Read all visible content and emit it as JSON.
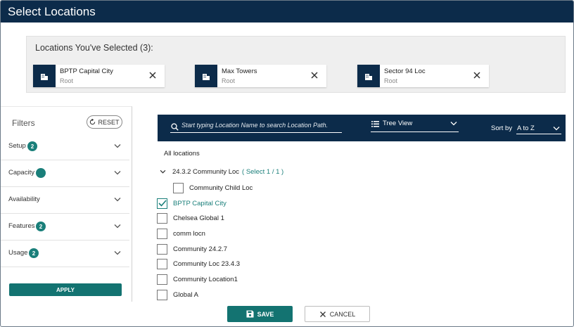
{
  "window": {
    "title": "Select Locations"
  },
  "selected": {
    "title": "Locations You've Selected (3):",
    "chips": [
      {
        "name": "BPTP Capital City",
        "path": "Root"
      },
      {
        "name": "Max Towers",
        "path": "Root"
      },
      {
        "name": "Sector 94 Loc",
        "path": "Root"
      }
    ]
  },
  "filters": {
    "title": "Filters",
    "reset_label": "RESET",
    "items": [
      {
        "label": "Setup",
        "badge": "2"
      },
      {
        "label": "Capacity",
        "badge": ""
      },
      {
        "label": "Availability",
        "badge": null
      },
      {
        "label": "Features",
        "badge": "2"
      },
      {
        "label": "Usage",
        "badge": "2"
      }
    ],
    "apply_label": "APPLY"
  },
  "toolbar": {
    "search_placeholder": "Start typing Location Name to search Location Path.",
    "view_label": "Tree View",
    "sort_label": "Sort by",
    "sort_value": "A to Z"
  },
  "tree": {
    "root_label": "All locations",
    "group": {
      "label": "24.3.2 Community Loc",
      "select_link": "( Select 1 / 1 )",
      "children": [
        {
          "label": "Community Child Loc",
          "checked": false
        }
      ]
    },
    "items": [
      {
        "label": "BPTP Capital City",
        "checked": true
      },
      {
        "label": "Chelsea Global 1",
        "checked": false
      },
      {
        "label": "comm locn",
        "checked": false
      },
      {
        "label": "Community 24.2.7",
        "checked": false
      },
      {
        "label": "Community Loc 23.4.3",
        "checked": false
      },
      {
        "label": "Community Location1",
        "checked": false
      },
      {
        "label": "Global A",
        "checked": false
      }
    ]
  },
  "footer": {
    "save_label": "SAVE",
    "cancel_label": "CANCEL"
  },
  "colors": {
    "navy": "#0c2b4a",
    "teal": "#137371",
    "accent_teal": "#1a7f7a"
  }
}
